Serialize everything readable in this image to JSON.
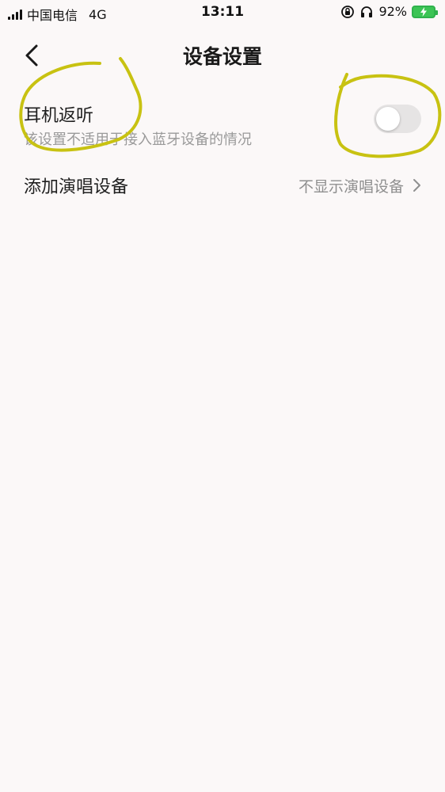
{
  "status_bar": {
    "carrier": "中国电信",
    "network": "4G",
    "time": "13:11",
    "battery_percent": "92%",
    "icons": [
      "signal-icon",
      "lock-rotation-icon",
      "headphones-icon",
      "battery-charging-icon"
    ]
  },
  "header": {
    "title": "设备设置",
    "back_icon": "chevron-left-icon"
  },
  "settings": {
    "ear_monitor": {
      "label": "耳机返听",
      "description": "该设置不适用于接入蓝牙设备的情况",
      "enabled": false
    },
    "singing_device": {
      "label": "添加演唱设备",
      "value": "不显示演唱设备",
      "chevron_icon": "chevron-right-icon"
    }
  },
  "colors": {
    "background": "#fbf8f8",
    "annotation": "#c8c212",
    "toggle_off": "#e6e4e4",
    "battery": "#3cc455"
  }
}
